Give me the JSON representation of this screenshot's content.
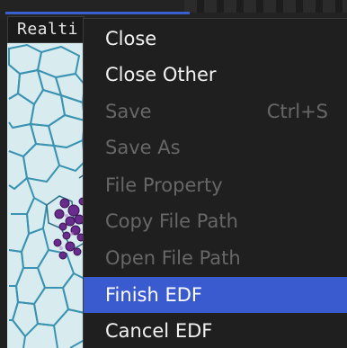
{
  "tab": {
    "label": "Realti"
  },
  "menu": {
    "items": [
      {
        "label": "Close",
        "shortcut": "",
        "state": "enabled"
      },
      {
        "label": "Close Other",
        "shortcut": "",
        "state": "enabled"
      },
      {
        "label": "Save",
        "shortcut": "Ctrl+S",
        "state": "disabled"
      },
      {
        "label": "Save As",
        "shortcut": "",
        "state": "disabled"
      },
      {
        "label": "File Property",
        "shortcut": "",
        "state": "disabled"
      },
      {
        "label": "Copy File Path",
        "shortcut": "",
        "state": "disabled"
      },
      {
        "label": "Open File Path",
        "shortcut": "",
        "state": "disabled"
      },
      {
        "label": "Finish EDF",
        "shortcut": "",
        "state": "highlighted"
      },
      {
        "label": "Cancel EDF",
        "shortcut": "",
        "state": "enabled"
      }
    ]
  },
  "colors": {
    "highlight": "#3a5bd0",
    "accent_line": "#3a5fcf",
    "menu_background": "#1f1f1f",
    "enabled_text": "#f2f2f2",
    "disabled_text": "#676767"
  }
}
